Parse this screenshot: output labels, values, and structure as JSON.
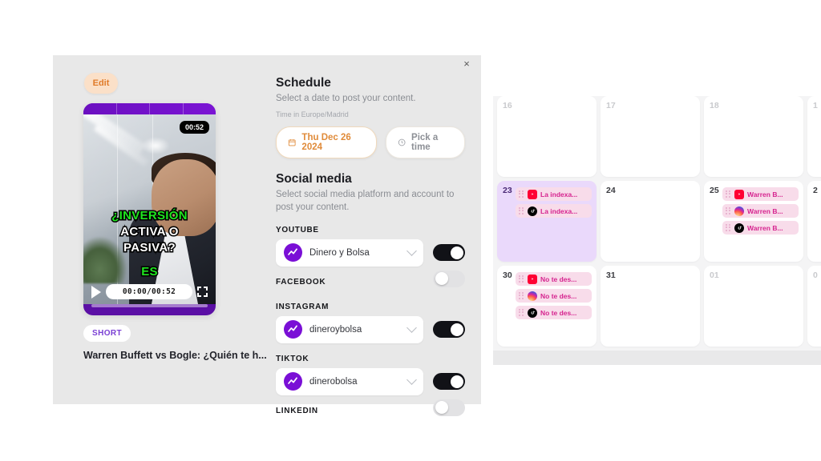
{
  "modal": {
    "close_label": "×",
    "left": {
      "edit_label": "Edit",
      "video": {
        "duration_badge": "00:52",
        "time_display": "00:00/00:52",
        "captions": [
          "¿INVERSIÓN",
          "ACTIVA O",
          "PASIVA?",
          "ES"
        ]
      },
      "badge": "SHORT",
      "title": "Warren Buffett vs Bogle: ¿Quién te h..."
    },
    "schedule": {
      "title": "Schedule",
      "subtitle": "Select a date to post your content.",
      "timezone": "Time in Europe/Madrid",
      "date_value": "Thu Dec 26 2024",
      "time_value": "Pick a time"
    },
    "social": {
      "title": "Social media",
      "subtitle": "Select social media platform and account to post your content.",
      "platforms": [
        {
          "label": "YOUTUBE",
          "account": "Dinero y Bolsa",
          "enabled": true,
          "has_account": true
        },
        {
          "label": "FACEBOOK",
          "account": "",
          "enabled": false,
          "has_account": false
        },
        {
          "label": "INSTAGRAM",
          "account": "dineroybolsa",
          "enabled": true,
          "has_account": true
        },
        {
          "label": "TIKTOK",
          "account": "dinerobolsa",
          "enabled": true,
          "has_account": true
        },
        {
          "label": "LINKEDIN",
          "account": "",
          "enabled": false,
          "has_account": false
        }
      ]
    }
  },
  "calendar": {
    "weeks": [
      {
        "days": [
          {
            "num": "16",
            "dim": true,
            "selected": false,
            "chips": []
          },
          {
            "num": "17",
            "dim": true,
            "selected": false,
            "chips": []
          },
          {
            "num": "18",
            "dim": true,
            "selected": false,
            "chips": []
          },
          {
            "num": "1",
            "dim": true,
            "selected": false,
            "partial": true,
            "chips": []
          }
        ]
      },
      {
        "days": [
          {
            "num": "23",
            "dim": false,
            "selected": true,
            "chips": [
              {
                "platform": "youtube",
                "text": "La indexa..."
              },
              {
                "platform": "tiktok",
                "text": "La indexa..."
              }
            ]
          },
          {
            "num": "24",
            "dim": false,
            "selected": false,
            "chips": []
          },
          {
            "num": "25",
            "dim": false,
            "selected": false,
            "chips": [
              {
                "platform": "youtube",
                "text": "Warren B..."
              },
              {
                "platform": "instagram",
                "text": "Warren B..."
              },
              {
                "platform": "tiktok",
                "text": "Warren B..."
              }
            ]
          },
          {
            "num": "2",
            "dim": false,
            "selected": false,
            "partial": true,
            "chips": []
          }
        ]
      },
      {
        "days": [
          {
            "num": "30",
            "dim": false,
            "selected": false,
            "chips": [
              {
                "platform": "youtube",
                "text": "No te des..."
              },
              {
                "platform": "instagram",
                "text": "No te des..."
              },
              {
                "platform": "tiktok",
                "text": "No te des..."
              }
            ]
          },
          {
            "num": "31",
            "dim": false,
            "selected": false,
            "chips": []
          },
          {
            "num": "01",
            "dim": true,
            "selected": false,
            "chips": []
          },
          {
            "num": "0",
            "dim": true,
            "selected": false,
            "partial": true,
            "chips": []
          }
        ]
      }
    ]
  }
}
